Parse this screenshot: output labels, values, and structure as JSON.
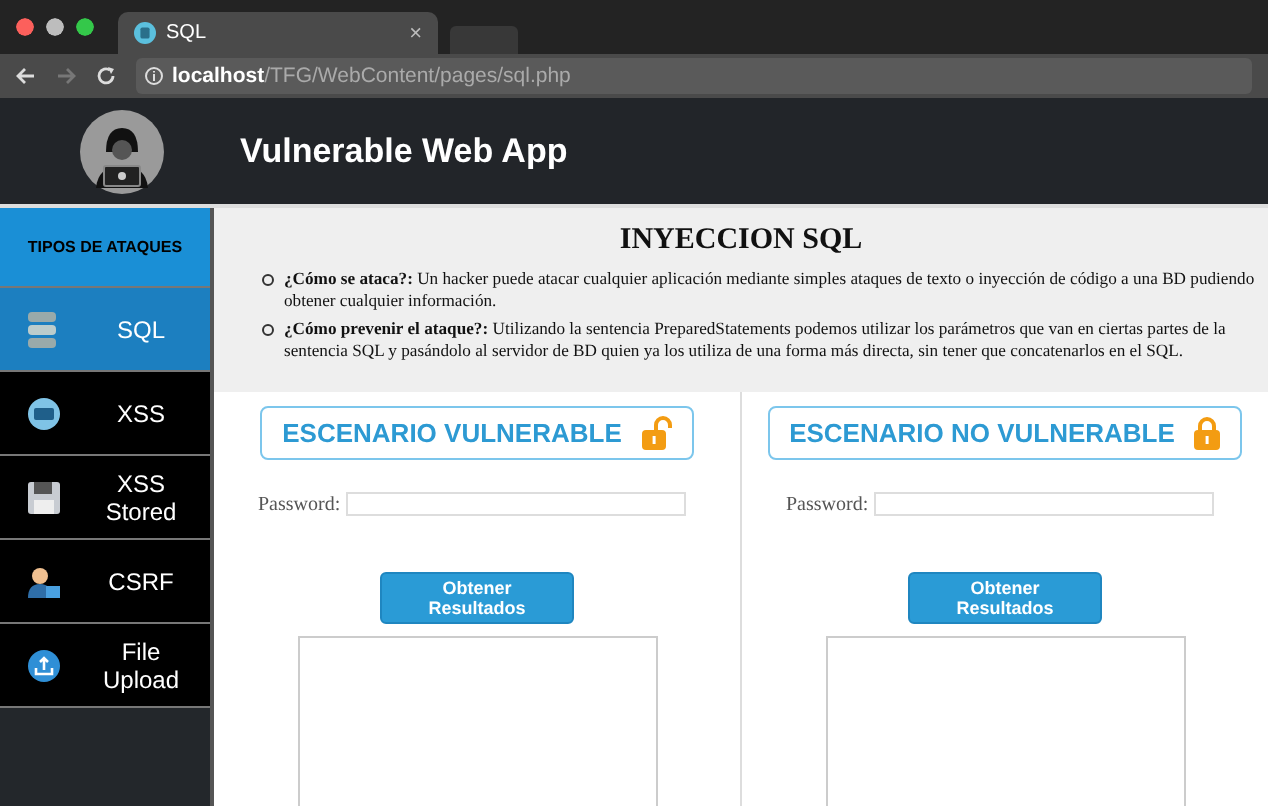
{
  "browser": {
    "tab": {
      "title": "SQL",
      "close": "×"
    },
    "url": "**localhost**/TFG/WebContent/pages/sql.php"
  },
  "header": {
    "title": "Vulnerable Web App"
  },
  "sidebar": {
    "heading": "TIPOS DE ATAQUES",
    "items": [
      {
        "label": "SQL",
        "kind": "database",
        "selected": true
      },
      {
        "label": "XSS",
        "kind": "code",
        "selected": false
      },
      {
        "label": "XSS Stored",
        "kind": "floppy",
        "selected": false
      },
      {
        "label": "CSRF",
        "kind": "person",
        "selected": false
      },
      {
        "label": "File Upload",
        "kind": "upload",
        "selected": false
      }
    ]
  },
  "info": {
    "title": "INYECCION SQL",
    "bullets": [
      "**¿Cómo se ataca?:** Un hacker puede atacar cualquier aplicación mediante simples ataques de texto o inyección de código a una BD pudiendo obtener cualquier información.",
      "**¿Cómo prevenir el ataque?:** Utilizando la sentencia PreparedStatements podemos utilizar los parámetros que van en ciertas partes de la sentencia SQL y pasándolo al servidor de BD quien ya los utiliza de una forma más directa, sin tener que concatenarlos en el SQL."
    ]
  },
  "scenarios": [
    {
      "title": "ESCENARIO VULNERABLE",
      "locked": false,
      "password_label": "Password:",
      "button": "Obtener Resultados"
    },
    {
      "title": "ESCENARIO NO VULNERABLE",
      "locked": true,
      "password_label": "Password:",
      "button": "Obtener Resultados"
    }
  ]
}
